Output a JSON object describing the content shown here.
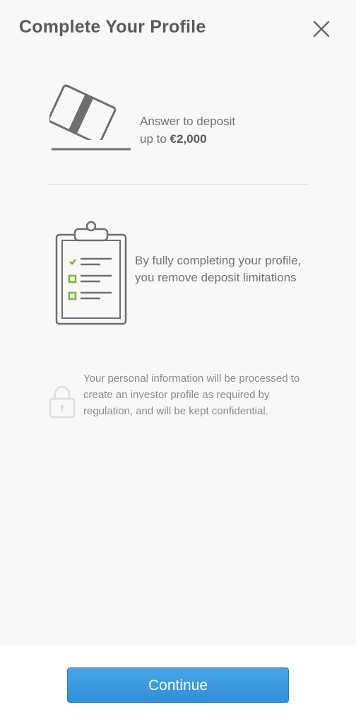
{
  "header": {
    "title": "Complete Your Profile",
    "close_icon": "close-icon"
  },
  "deposit_info": {
    "icon": "credit-card-icon",
    "line1": "Answer to deposit",
    "line2_prefix": "up to ",
    "amount": "€2,000"
  },
  "limitations_info": {
    "icon": "clipboard-checklist-icon",
    "text": "By fully completing your profile, you remove deposit limitations"
  },
  "privacy_info": {
    "icon": "lock-icon",
    "text": "Your personal information will be processed to create an investor profile as required by regulation, and will be kept confidential."
  },
  "footer": {
    "continue_label": "Continue"
  },
  "colors": {
    "accent_blue": "#3a9ae0",
    "check_green": "#7ab62e",
    "text_dark": "#5a5a5a",
    "text_muted": "#727272"
  }
}
